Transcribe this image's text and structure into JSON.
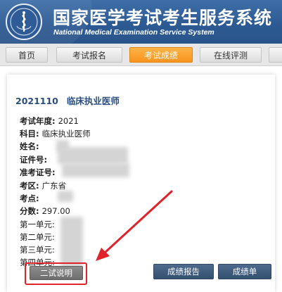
{
  "header": {
    "title_cn": "国家医学考试考生服务系统",
    "title_en": "National Medical Examination Service System",
    "logo_icon": "medical-exam-logo-icon",
    "bg_color": "#2d5a93"
  },
  "nav": {
    "tabs": [
      {
        "label": "首页",
        "active": false
      },
      {
        "label": "考试报名",
        "active": false
      },
      {
        "label": "考试成绩",
        "active": true
      },
      {
        "label": "在线评测",
        "active": false
      }
    ],
    "active_color": "#f7941d"
  },
  "result": {
    "exam_code": "2021110",
    "exam_name": "临床执业医师",
    "fields": {
      "year": {
        "label": "考试年度:",
        "value": "2021"
      },
      "subject": {
        "label": "科目:",
        "value": "临床执业医师"
      },
      "name": {
        "label": "姓名:",
        "value": ""
      },
      "id_no": {
        "label": "证件号:",
        "value": ""
      },
      "ticket_no": {
        "label": "准考证号:",
        "value": ""
      },
      "region": {
        "label": "考区:",
        "value": "广东省"
      },
      "site": {
        "label": "考点:",
        "value": ""
      },
      "score": {
        "label": "分数:",
        "value": "297.00"
      }
    },
    "units": [
      {
        "label": "第一单元:"
      },
      {
        "label": "第二单元:"
      },
      {
        "label": "第三单元:"
      },
      {
        "label": "第四单元:"
      }
    ]
  },
  "buttons": {
    "second_exam": "二试说明",
    "score_report": "成绩报告",
    "score_sheet": "成绩单"
  },
  "annotation": {
    "color": "#e0232b"
  }
}
